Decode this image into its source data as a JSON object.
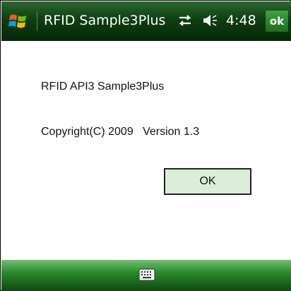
{
  "titlebar": {
    "start_icon": "windows-flag-icon",
    "title": "RFID Sample3Plus",
    "connectivity_icon": "connectivity-arrows-icon",
    "volume_icon": "speaker-icon",
    "time": "4:48",
    "ok_label": "ok"
  },
  "dialog": {
    "line1": "RFID API3 Sample3Plus",
    "copyright": "Copyright(C) 2009",
    "version": "Version 1.3",
    "ok_button": "OK"
  },
  "bottombar": {
    "keyboard_icon": "keyboard-icon"
  },
  "colors": {
    "titlebar": "#0f3e12",
    "button_bg": "#dcedd9",
    "bottombar": "#2b8a2b"
  }
}
